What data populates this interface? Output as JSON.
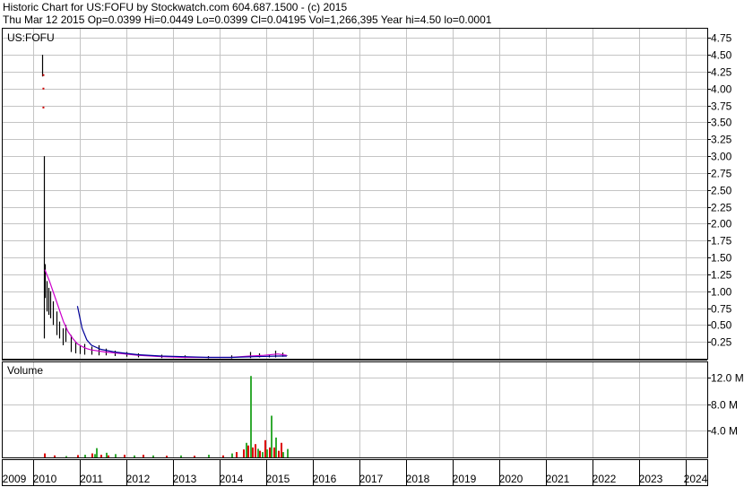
{
  "header": {
    "line1": "Historic Chart for US:FOFU by Stockwatch.com 604.687.1500 - (c) 2015",
    "line2": "Thu Mar 12 2015  Op=0.0399  Hi=0.0449  Lo=0.0399  Cl=0.04195  Vol=1,266,395  Year hi=4.50  lo=0.0001"
  },
  "colors": {
    "grid": "#c4c4c4",
    "frame": "#000000",
    "price_bar": "#000000",
    "ma_short": "#cc00cc",
    "ma_long": "#000099",
    "volume_up": "#33aa33",
    "volume_down": "#dd0000",
    "marker": "#cc0000"
  },
  "chart_data": [
    {
      "type": "line",
      "title": "US:FOFU",
      "ylim": [
        0,
        4.9
      ],
      "xlim": [
        2009,
        2024.5
      ],
      "y_ticks": [
        "0.25",
        "0.50",
        "0.75",
        "1.00",
        "1.25",
        "1.50",
        "1.75",
        "2.00",
        "2.25",
        "2.50",
        "2.75",
        "3.00",
        "3.25",
        "3.50",
        "3.75",
        "4.00",
        "4.25",
        "4.50",
        "4.75"
      ],
      "y_tick_values": [
        0.25,
        0.5,
        0.75,
        1.0,
        1.25,
        1.5,
        1.75,
        2.0,
        2.25,
        2.5,
        2.75,
        3.0,
        3.25,
        3.5,
        3.75,
        4.0,
        4.25,
        4.5,
        4.75
      ],
      "price_bars": [
        {
          "x": 2009.95,
          "hi": 4.5,
          "lo": 4.18
        },
        {
          "x": 2009.98,
          "hi": 3.0,
          "lo": 0.3
        },
        {
          "x": 2010.0,
          "hi": 1.4,
          "lo": 0.9
        },
        {
          "x": 2010.04,
          "hi": 1.15,
          "lo": 0.7
        },
        {
          "x": 2010.08,
          "hi": 1.05,
          "lo": 0.65
        },
        {
          "x": 2010.12,
          "hi": 1.0,
          "lo": 0.6
        },
        {
          "x": 2010.18,
          "hi": 0.85,
          "lo": 0.5
        },
        {
          "x": 2010.25,
          "hi": 0.7,
          "lo": 0.35
        },
        {
          "x": 2010.3,
          "hi": 0.55,
          "lo": 0.3
        },
        {
          "x": 2010.38,
          "hi": 0.45,
          "lo": 0.2
        },
        {
          "x": 2010.45,
          "hi": 0.5,
          "lo": 0.25
        },
        {
          "x": 2010.55,
          "hi": 0.35,
          "lo": 0.1
        },
        {
          "x": 2010.65,
          "hi": 0.25,
          "lo": 0.08
        },
        {
          "x": 2010.75,
          "hi": 0.2,
          "lo": 0.07
        },
        {
          "x": 2010.85,
          "hi": 0.22,
          "lo": 0.06
        },
        {
          "x": 2011.0,
          "hi": 0.18,
          "lo": 0.06
        },
        {
          "x": 2011.15,
          "hi": 0.2,
          "lo": 0.05
        },
        {
          "x": 2011.3,
          "hi": 0.15,
          "lo": 0.05
        },
        {
          "x": 2011.5,
          "hi": 0.12,
          "lo": 0.04
        },
        {
          "x": 2011.75,
          "hi": 0.1,
          "lo": 0.03
        },
        {
          "x": 2012.0,
          "hi": 0.08,
          "lo": 0.02
        },
        {
          "x": 2012.5,
          "hi": 0.06,
          "lo": 0.01
        },
        {
          "x": 2013.0,
          "hi": 0.05,
          "lo": 0.01
        },
        {
          "x": 2013.5,
          "hi": 0.04,
          "lo": 0.005
        },
        {
          "x": 2014.0,
          "hi": 0.05,
          "lo": 0.005
        },
        {
          "x": 2014.4,
          "hi": 0.1,
          "lo": 0.01
        },
        {
          "x": 2014.6,
          "hi": 0.08,
          "lo": 0.02
        },
        {
          "x": 2014.8,
          "hi": 0.06,
          "lo": 0.02
        },
        {
          "x": 2014.95,
          "hi": 0.12,
          "lo": 0.02
        },
        {
          "x": 2015.1,
          "hi": 0.09,
          "lo": 0.03
        },
        {
          "x": 2015.19,
          "hi": 0.0449,
          "lo": 0.0399
        }
      ],
      "markers": [
        {
          "x": 2009.97,
          "y": 4.2
        },
        {
          "x": 2009.97,
          "y": 4.0
        },
        {
          "x": 2009.97,
          "y": 3.72
        }
      ],
      "series": [
        {
          "key": "ma_short",
          "x": [
            2010.0,
            2010.1,
            2010.2,
            2010.3,
            2010.4,
            2010.5,
            2010.6,
            2010.7,
            2010.8,
            2010.9,
            2011.0,
            2011.3,
            2011.6,
            2012.0,
            2012.5,
            2013.0,
            2013.5,
            2014.0,
            2014.4,
            2014.7,
            2015.0,
            2015.19
          ],
          "values": [
            1.32,
            1.15,
            0.95,
            0.75,
            0.55,
            0.4,
            0.3,
            0.22,
            0.18,
            0.15,
            0.13,
            0.1,
            0.08,
            0.05,
            0.03,
            0.02,
            0.02,
            0.02,
            0.04,
            0.05,
            0.07,
            0.05
          ]
        },
        {
          "key": "ma_long",
          "x": [
            2010.7,
            2010.8,
            2010.9,
            2011.0,
            2011.2,
            2011.5,
            2012.0,
            2012.5,
            2013.0,
            2013.5,
            2014.0,
            2014.5,
            2015.0,
            2015.19
          ],
          "values": [
            0.78,
            0.45,
            0.28,
            0.2,
            0.14,
            0.1,
            0.06,
            0.04,
            0.03,
            0.02,
            0.02,
            0.03,
            0.04,
            0.04
          ]
        }
      ]
    },
    {
      "type": "bar",
      "title": "Volume",
      "ylim": [
        0,
        14.5
      ],
      "y_ticks": [
        "4.0 M",
        "8.0 M",
        "12.0 M"
      ],
      "y_tick_values": [
        4,
        8,
        12
      ],
      "bars": [
        {
          "x": 2009.98,
          "v": 0.6,
          "dir": "down"
        },
        {
          "x": 2010.2,
          "v": 0.3,
          "dir": "down"
        },
        {
          "x": 2010.45,
          "v": 0.2,
          "dir": "up"
        },
        {
          "x": 2010.7,
          "v": 0.35,
          "dir": "down"
        },
        {
          "x": 2010.85,
          "v": 0.4,
          "dir": "up"
        },
        {
          "x": 2011.0,
          "v": 0.6,
          "dir": "down"
        },
        {
          "x": 2011.05,
          "v": 0.5,
          "dir": "up"
        },
        {
          "x": 2011.1,
          "v": 1.4,
          "dir": "up"
        },
        {
          "x": 2011.2,
          "v": 0.4,
          "dir": "down"
        },
        {
          "x": 2011.3,
          "v": 0.7,
          "dir": "up"
        },
        {
          "x": 2011.35,
          "v": 0.3,
          "dir": "down"
        },
        {
          "x": 2011.5,
          "v": 0.5,
          "dir": "up"
        },
        {
          "x": 2011.7,
          "v": 0.4,
          "dir": "down"
        },
        {
          "x": 2011.9,
          "v": 0.3,
          "dir": "up"
        },
        {
          "x": 2012.1,
          "v": 0.4,
          "dir": "down"
        },
        {
          "x": 2012.3,
          "v": 0.3,
          "dir": "up"
        },
        {
          "x": 2012.6,
          "v": 0.25,
          "dir": "down"
        },
        {
          "x": 2012.9,
          "v": 0.3,
          "dir": "up"
        },
        {
          "x": 2013.2,
          "v": 0.25,
          "dir": "down"
        },
        {
          "x": 2013.5,
          "v": 0.4,
          "dir": "up"
        },
        {
          "x": 2013.8,
          "v": 0.3,
          "dir": "down"
        },
        {
          "x": 2014.0,
          "v": 0.6,
          "dir": "up"
        },
        {
          "x": 2014.1,
          "v": 0.8,
          "dir": "down"
        },
        {
          "x": 2014.25,
          "v": 1.2,
          "dir": "down"
        },
        {
          "x": 2014.3,
          "v": 2.2,
          "dir": "up"
        },
        {
          "x": 2014.35,
          "v": 1.8,
          "dir": "down"
        },
        {
          "x": 2014.4,
          "v": 12.3,
          "dir": "up"
        },
        {
          "x": 2014.45,
          "v": 1.5,
          "dir": "down"
        },
        {
          "x": 2014.5,
          "v": 2.0,
          "dir": "down"
        },
        {
          "x": 2014.55,
          "v": 1.3,
          "dir": "up"
        },
        {
          "x": 2014.6,
          "v": 1.0,
          "dir": "down"
        },
        {
          "x": 2014.65,
          "v": 0.8,
          "dir": "up"
        },
        {
          "x": 2014.72,
          "v": 2.6,
          "dir": "down"
        },
        {
          "x": 2014.75,
          "v": 1.2,
          "dir": "up"
        },
        {
          "x": 2014.8,
          "v": 1.5,
          "dir": "down"
        },
        {
          "x": 2014.85,
          "v": 6.3,
          "dir": "up"
        },
        {
          "x": 2014.9,
          "v": 1.5,
          "dir": "down"
        },
        {
          "x": 2014.95,
          "v": 3.0,
          "dir": "up"
        },
        {
          "x": 2015.0,
          "v": 1.0,
          "dir": "down"
        },
        {
          "x": 2015.05,
          "v": 2.2,
          "dir": "down"
        },
        {
          "x": 2015.1,
          "v": 0.8,
          "dir": "up"
        },
        {
          "x": 2015.19,
          "v": 1.27,
          "dir": "up"
        }
      ]
    }
  ],
  "x_axis": {
    "labels": [
      "2009",
      "2010",
      "2011",
      "2012",
      "2013",
      "2014",
      "2015",
      "2016",
      "2017",
      "2018",
      "2019",
      "2020",
      "2021",
      "2022",
      "2023",
      "2024"
    ],
    "values": [
      2009,
      2010,
      2011,
      2012,
      2013,
      2014,
      2015,
      2016,
      2017,
      2018,
      2019,
      2020,
      2021,
      2022,
      2023,
      2024
    ]
  }
}
